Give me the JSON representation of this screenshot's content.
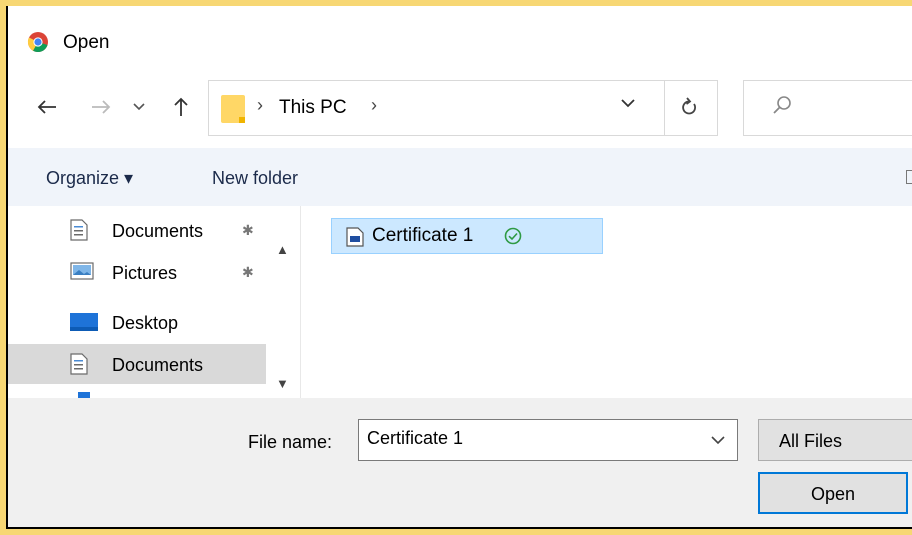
{
  "window": {
    "title": "Open"
  },
  "nav": {
    "breadcrumb": "This PC",
    "search": {
      "placeholder": ""
    }
  },
  "toolbar": {
    "organize_label": "Organize ▾",
    "new_folder_label": "New folder"
  },
  "sidebar": {
    "items": [
      {
        "label": "Documents",
        "icon": "documents-icon",
        "pinned": true
      },
      {
        "label": "Pictures",
        "icon": "pictures-icon",
        "pinned": true
      },
      {
        "label": "Desktop",
        "icon": "desktop-icon",
        "pinned": false
      },
      {
        "label": "Documents",
        "icon": "documents-icon",
        "pinned": false,
        "selected": true
      }
    ]
  },
  "files": [
    {
      "name": "Certificate 1",
      "status": "synced"
    }
  ],
  "footer": {
    "file_name_label": "File name:",
    "file_name_value": "Certificate 1",
    "file_type": "All Files",
    "open_label": "Open"
  },
  "colors": {
    "border_accent": "#f7d774",
    "selection": "#cce8ff",
    "primary_button_border": "#0078d7"
  }
}
